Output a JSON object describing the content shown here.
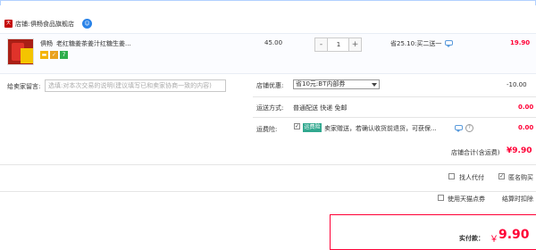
{
  "shop": {
    "label": "店铺:",
    "name": "俱畅食品旗舰店",
    "tmall_badge": "天猫"
  },
  "item": {
    "brand": "俱畅",
    "title": "老红糖姜茶姜汁红糖生姜...",
    "unit_price": "45.00",
    "quantity": "1",
    "promo": "省25.10:买二送一",
    "subtotal": "19.90",
    "qty_minus": "-",
    "qty_plus": "+",
    "service_icons": [
      "card-icon",
      "shield-icon",
      "seven-day-icon"
    ],
    "service_seven": "7"
  },
  "message": {
    "label": "给卖家留言:",
    "placeholder": "选填:对本次交易的说明(建议填写已和卖家协商一致的内容)"
  },
  "coupon": {
    "label": "店铺优惠:",
    "selected": "省10元:BT内部券",
    "value": "-10.00"
  },
  "shipping": {
    "label": "运送方式:",
    "method": "普通配送 快递 免邮",
    "value": "0.00"
  },
  "insurance": {
    "label": "运费险:",
    "badge": "运费险",
    "text": "卖家赠送，若确认收货前退货，可获保...",
    "value": "0.00"
  },
  "shop_total": {
    "label": "店铺合计(含运费)",
    "value": "¥9.90"
  },
  "options": {
    "pay_for": "找人代付",
    "anonymous": "匿名购买",
    "tmall_points": "使用天猫点券",
    "settle_deduct": "结算时扣除"
  },
  "bottom": {
    "actual_label": "实付款：",
    "currency": "￥",
    "amount": "9.90"
  },
  "colors": {
    "accent_red": "#ff0036",
    "tmall_red": "#c40000",
    "link_blue": "#2a83e8",
    "insurance_green": "#31a88f"
  }
}
